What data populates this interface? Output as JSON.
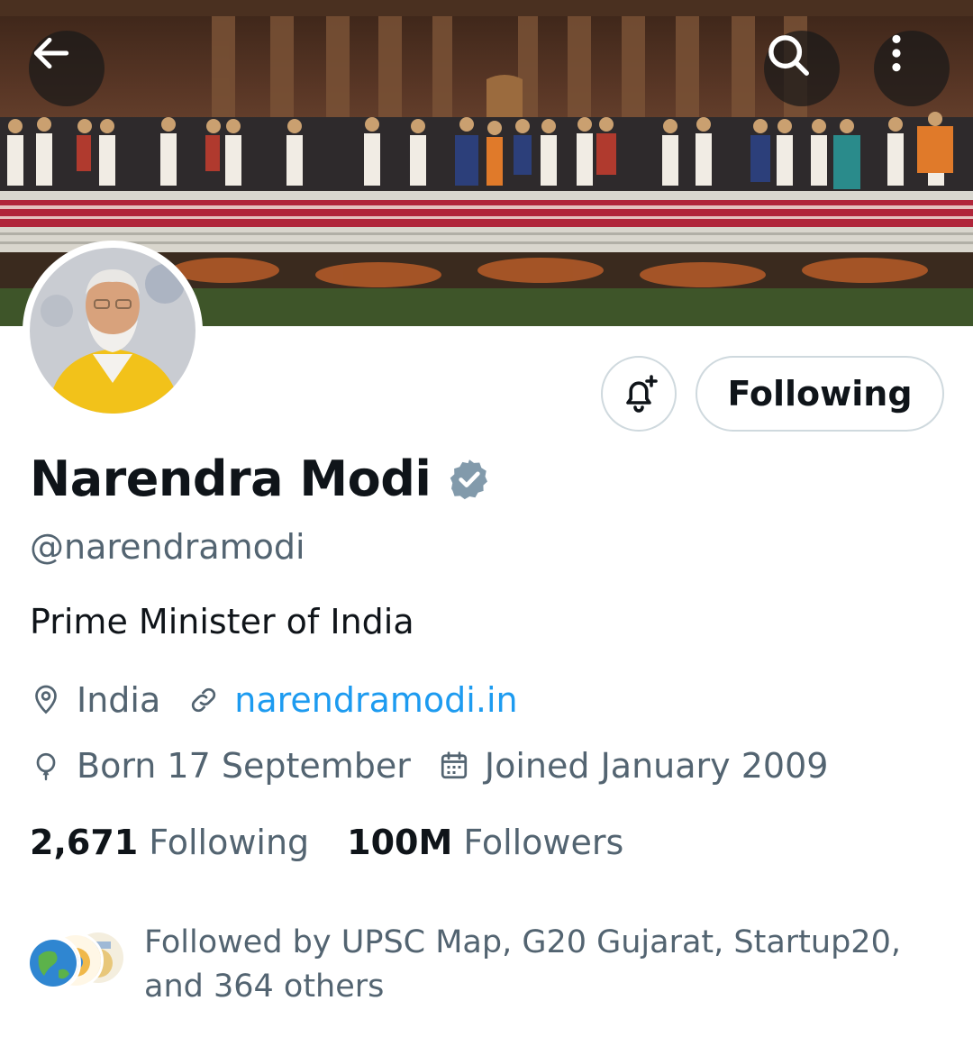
{
  "banner": {
    "back_icon": "arrow-left-icon",
    "search_icon": "search-icon",
    "more_icon": "more-vertical-icon"
  },
  "profile": {
    "name": "Narendra Modi",
    "handle": "@narendramodi",
    "bio": "Prime Minister of India",
    "location": "India",
    "website": "narendramodi.in",
    "birthday": "Born 17 September",
    "joined": "Joined January 2009"
  },
  "actions": {
    "following_label": "Following",
    "bell_icon": "bell-plus-icon"
  },
  "stats": {
    "following_count": "2,671",
    "following_label": "Following",
    "followers_count": "100M",
    "followers_label": "Followers"
  },
  "followed_by": {
    "text": "Followed by UPSC Map, G20 Gujarat, Startup20, and 364 others"
  },
  "colors": {
    "link": "#1d9bf0",
    "secondary_text": "#536471",
    "primary_text": "#0f1419",
    "border": "#cfd9de",
    "verified_badge": "#829aab"
  }
}
